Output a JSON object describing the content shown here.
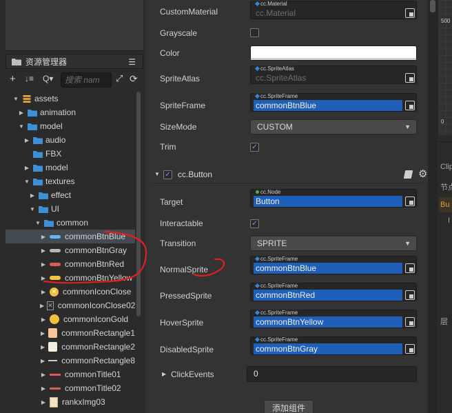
{
  "asset_manager": {
    "title": "资源管理器",
    "search_placeholder": "搜索 nam",
    "toolbar": {
      "add": "+",
      "sort": "↓≡",
      "search_menu": "Q▾",
      "expand": "⤢",
      "refresh": "⟳"
    },
    "tree": [
      {
        "label": "assets",
        "icon": "database-icon"
      },
      {
        "label": "animation",
        "icon": "folder-icon"
      },
      {
        "label": "model",
        "icon": "folder-icon"
      },
      {
        "label": "audio",
        "icon": "folder-icon"
      },
      {
        "label": "FBX",
        "icon": "folder-icon"
      },
      {
        "label": "model",
        "icon": "folder-icon"
      },
      {
        "label": "textures",
        "icon": "folder-icon"
      },
      {
        "label": "effect",
        "icon": "folder-icon"
      },
      {
        "label": "UI",
        "icon": "folder-icon"
      },
      {
        "label": "common",
        "icon": "folder-icon"
      },
      {
        "label": "commonBtnBlue",
        "icon": "sprite-blue-icon"
      },
      {
        "label": "commonBtnGray",
        "icon": "sprite-gray-icon"
      },
      {
        "label": "commonBtnRed",
        "icon": "sprite-red-icon"
      },
      {
        "label": "commonBtnYellow",
        "icon": "sprite-yellow-icon"
      },
      {
        "label": "commonIconClose",
        "icon": "close-circle-icon"
      },
      {
        "label": "commonIconClose02",
        "icon": "close-box-icon"
      },
      {
        "label": "commonIconGold",
        "icon": "gold-coin-icon"
      },
      {
        "label": "commonRectangle1",
        "icon": "rect-peach-icon"
      },
      {
        "label": "commonRectangle2",
        "icon": "rect-white-icon"
      },
      {
        "label": "commonRectangle8",
        "icon": "line-white-icon"
      },
      {
        "label": "commonTitle01",
        "icon": "line-red-icon"
      },
      {
        "label": "commonTitle02",
        "icon": "line-red-icon"
      },
      {
        "label": "rankxImg03",
        "icon": "rank-image-icon"
      }
    ]
  },
  "inspector": {
    "labels": {
      "custom_material": "CustomMaterial",
      "grayscale": "Grayscale",
      "color": "Color",
      "sprite_atlas": "SpriteAtlas",
      "sprite_frame": "SpriteFrame",
      "size_mode": "SizeMode",
      "trim": "Trim",
      "target": "Target",
      "interactable": "Interactable",
      "transition": "Transition",
      "normal_sprite": "NormalSprite",
      "pressed_sprite": "PressedSprite",
      "hover_sprite": "HoverSprite",
      "disabled_sprite": "DisabledSprite",
      "click_events": "ClickEvents"
    },
    "tags": {
      "material": "cc.Material",
      "sprite_atlas": "cc.SpriteAtlas",
      "sprite_frame": "cc.SpriteFrame",
      "node": "cc.Node"
    },
    "values": {
      "custom_material": "cc.Material",
      "sprite_atlas": "cc.SpriteAtlas",
      "sprite_frame": "commonBtnBlue",
      "size_mode": "CUSTOM",
      "target": "Button",
      "transition": "SPRITE",
      "normal_sprite": "commonBtnBlue",
      "pressed_sprite": "commonBtnRed",
      "hover_sprite": "commonBtnYellow",
      "disabled_sprite": "commonBtnGray",
      "click_events": "0"
    },
    "checks": {
      "grayscale": "",
      "trim": "✓",
      "interactable": "✓",
      "button_enabled": "✓"
    },
    "color_value": "#ffffff",
    "component_name": "cc.Button",
    "add_component": "添加组件"
  },
  "right_panel": {
    "ruler_top": "500",
    "ruler_bottom": "0",
    "text1": "Clip",
    "text2": "节点",
    "text3": "Bu",
    "text4": "I",
    "text5": "层"
  },
  "colors": {
    "selection": "#1f5fb8",
    "annotation": "#e02020"
  }
}
